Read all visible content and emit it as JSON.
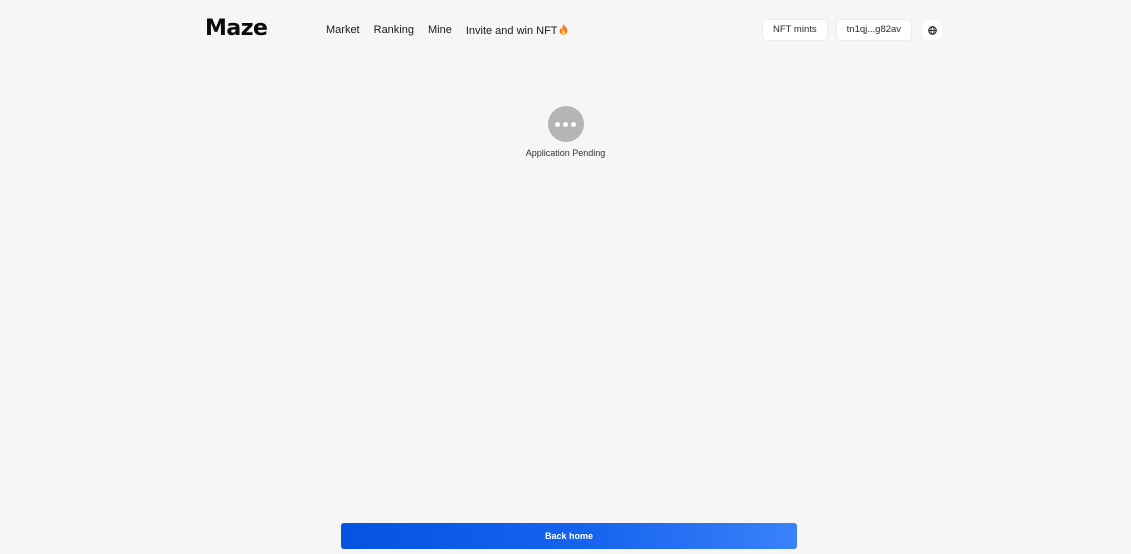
{
  "header": {
    "logo": "Maze",
    "nav": [
      {
        "label": "Market"
      },
      {
        "label": "Ranking"
      },
      {
        "label": "Mine"
      },
      {
        "label": "Invite and win NFT",
        "icon": "fire-icon"
      }
    ],
    "nft_mints_label": "NFT mints",
    "wallet_address": "tn1qj...g82av",
    "language_icon": "globe-icon"
  },
  "status": {
    "icon": "more-dots-icon",
    "text": "Application Pending"
  },
  "back_home_label": "Back home",
  "colors": {
    "background": "#f6f6f6",
    "accent": "#0a58e6",
    "pending_icon": "#b5b5b5"
  }
}
